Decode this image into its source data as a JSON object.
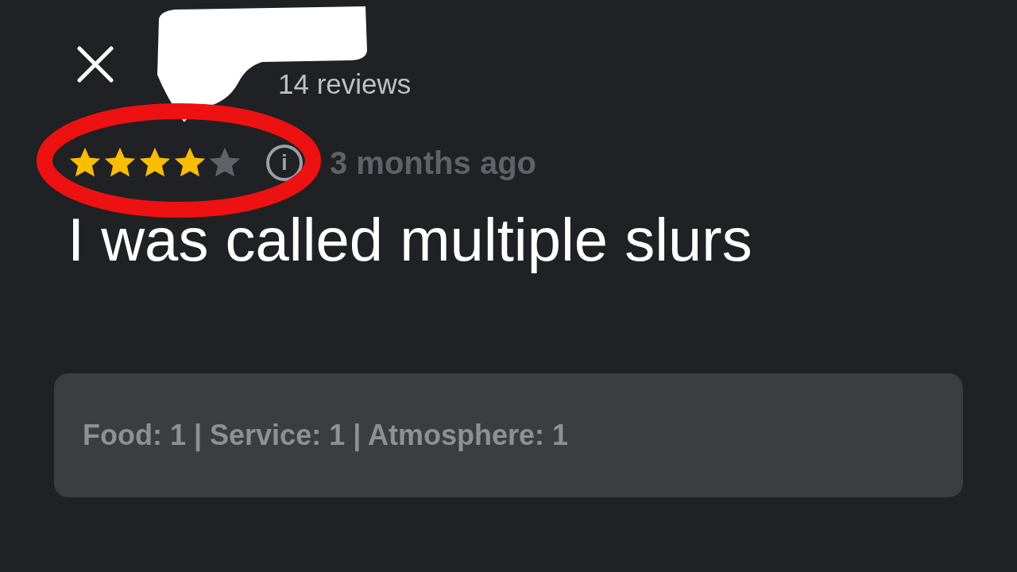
{
  "review": {
    "reviewer_review_count": "14 reviews",
    "stars": 4,
    "info_icon": "i",
    "time": "3 months ago",
    "text": "I was called multiple slurs",
    "ratings": "Food: 1 | Service: 1 | Atmosphere: 1"
  }
}
